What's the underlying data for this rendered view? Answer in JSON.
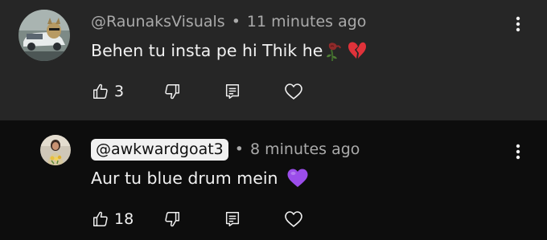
{
  "comments": [
    {
      "author": "@RaunaksVisuals",
      "separator": "•",
      "time": "11 minutes ago",
      "text": "Behen tu insta pe hi Thik he",
      "emojis": [
        "wilted-rose-emoji",
        "broken-heart-emoji"
      ],
      "likes": "3",
      "avatar": "car-avatar"
    },
    {
      "author": "@awkwardgoat3",
      "separator": "•",
      "time": "8 minutes ago",
      "text": "Aur tu blue drum mein",
      "emojis": [
        "purple-heart-emoji"
      ],
      "likes": "18",
      "avatar": "person-avatar"
    }
  ],
  "icons": {
    "like": "thumbs-up-icon",
    "dislike": "thumbs-down-icon",
    "reply": "reply-icon",
    "save": "heart-icon",
    "menu": "more-vert-icon"
  },
  "colors": {
    "top_bg": "#262626",
    "reply_bg": "#0d0d0d",
    "text": "#f1f1f1",
    "meta": "#aaaaaa",
    "broken_heart": "#e0323a",
    "purple_heart": "#9b4dea"
  }
}
